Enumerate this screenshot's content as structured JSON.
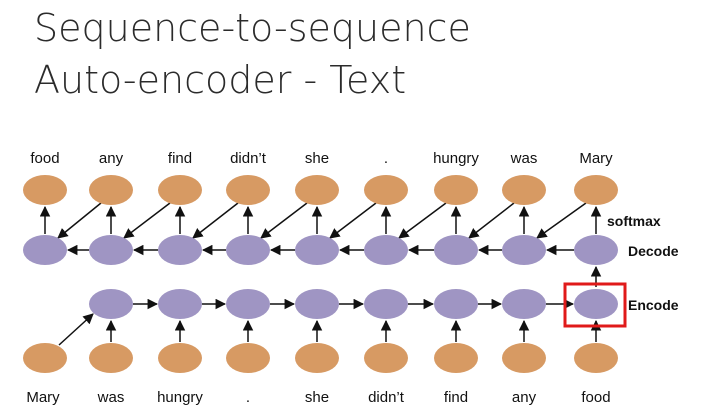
{
  "slide": {
    "title_line1": "Sequence-to-sequence",
    "title_line2": "Auto-encoder - Text"
  },
  "diagram": {
    "output_words": [
      "food",
      "any",
      "find",
      "didn’t",
      "she",
      ".",
      "hungry",
      "was",
      "Mary"
    ],
    "input_words": [
      "Mary",
      "was",
      "hungry",
      ".",
      "she",
      "didn’t",
      "find",
      "any",
      "food"
    ],
    "labels": {
      "softmax": "softmax",
      "decode": "Decode",
      "encode": "Encode"
    },
    "colors": {
      "word_node": "#d79a63",
      "hidden_node": "#9f95c3",
      "highlight_box": "#e01a1a",
      "arrow": "#111111"
    },
    "highlighted_node": "final encoder state"
  }
}
